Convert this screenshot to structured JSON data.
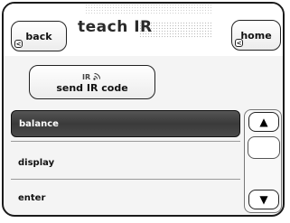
{
  "header": {
    "title": "teach IR",
    "back_label": "back",
    "home_label": "home"
  },
  "send_button": {
    "icon_text": "IR",
    "label": "send IR code"
  },
  "list": {
    "items": [
      {
        "label": "balance",
        "selected": true
      },
      {
        "label": "display",
        "selected": false
      },
      {
        "label": "enter",
        "selected": false
      }
    ]
  },
  "icons": {
    "back": "corner-back-arrow-icon",
    "home": "corner-back-arrow-icon",
    "send": "ir-signal-icon",
    "scroll_up": "up-triangle-icon",
    "scroll_down": "down-triangle-icon"
  }
}
